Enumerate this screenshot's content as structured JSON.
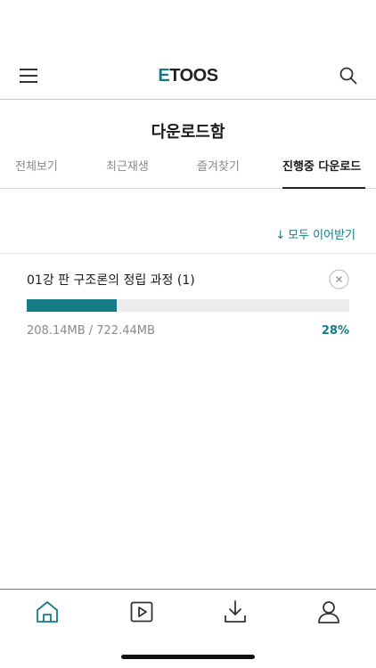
{
  "header": {
    "logo_first_letter": "E",
    "logo_rest": "TOOS",
    "menu_icon": "hamburger-menu-icon",
    "search_icon": "search-icon"
  },
  "page": {
    "title": "다운로드함"
  },
  "tabs": [
    {
      "label": "전체보기",
      "active": false
    },
    {
      "label": "최근재생",
      "active": false
    },
    {
      "label": "즐겨찾기",
      "active": false
    },
    {
      "label": "진행중 다운로드",
      "active": true
    }
  ],
  "actions": {
    "resume_all_label": "모두 이어받기",
    "resume_all_icon": "down-arrow-icon"
  },
  "downloads": [
    {
      "title": "01강 판 구조론의 정립 과정 (1)",
      "size_text": "208.14MB / 722.44MB",
      "percent_text": "28%",
      "progress_fraction": 0.28
    }
  ],
  "bottom_nav": [
    {
      "icon": "home-icon",
      "active": true
    },
    {
      "icon": "play-icon",
      "active": false
    },
    {
      "icon": "download-icon",
      "active": false
    },
    {
      "icon": "user-icon",
      "active": false
    }
  ],
  "colors": {
    "accent": "#167c85",
    "text": "#1a1a1a",
    "muted": "#8a8a8a",
    "track": "#ececec"
  }
}
